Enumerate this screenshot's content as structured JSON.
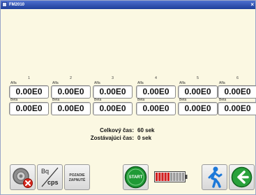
{
  "window": {
    "title": "FM2010",
    "close_glyph": "×"
  },
  "channels": [
    {
      "number": "1",
      "alfa_label": "Alfa",
      "alfa_value": "0.00E0",
      "beta_label": "Beta",
      "beta_value": "0.00E0"
    },
    {
      "number": "2",
      "alfa_label": "Alfa",
      "alfa_value": "0.00E0",
      "beta_label": "Beta",
      "beta_value": "0.00E0"
    },
    {
      "number": "3",
      "alfa_label": "Alfa",
      "alfa_value": "0.00E0",
      "beta_label": "Beta",
      "beta_value": "0.00E0"
    },
    {
      "number": "4",
      "alfa_label": "Alfa",
      "alfa_value": "0.00E0",
      "beta_label": "Beta",
      "beta_value": "0.00E0"
    },
    {
      "number": "5",
      "alfa_label": "Alfa",
      "alfa_value": "0.00E0",
      "beta_label": "Beta",
      "beta_value": "0.00E0"
    },
    {
      "number": "6",
      "alfa_label": "Alfa",
      "alfa_value": "0.00E0",
      "beta_label": "Beta",
      "beta_value": "0.00E0"
    }
  ],
  "summary": {
    "total_time_label": "Celkový čas:",
    "total_time_value": "60 sek",
    "remaining_time_label": "Zostávajúci čas:",
    "remaining_time_value": "0 sek"
  },
  "toolbar": {
    "units_top": "Bq",
    "units_bottom": "cps",
    "background_line1": "POZADIE",
    "background_line2": "ZAPNUTÉ",
    "start_label": "START",
    "battery_level": 0.5
  },
  "icons": {
    "settings": "gear-disabled-icon",
    "units": "units-switch-icon",
    "start": "start-icon",
    "battery": "battery-icon",
    "walk": "walking-person-icon",
    "back": "back-arrow-icon"
  },
  "colors": {
    "title_bar": "#2b4fb0",
    "window_bg": "#fbf8e2",
    "start_green": "#1f9a35",
    "battery_red": "#d42020",
    "back_green": "#2aa23c",
    "walk_blue": "#1c78d8"
  }
}
